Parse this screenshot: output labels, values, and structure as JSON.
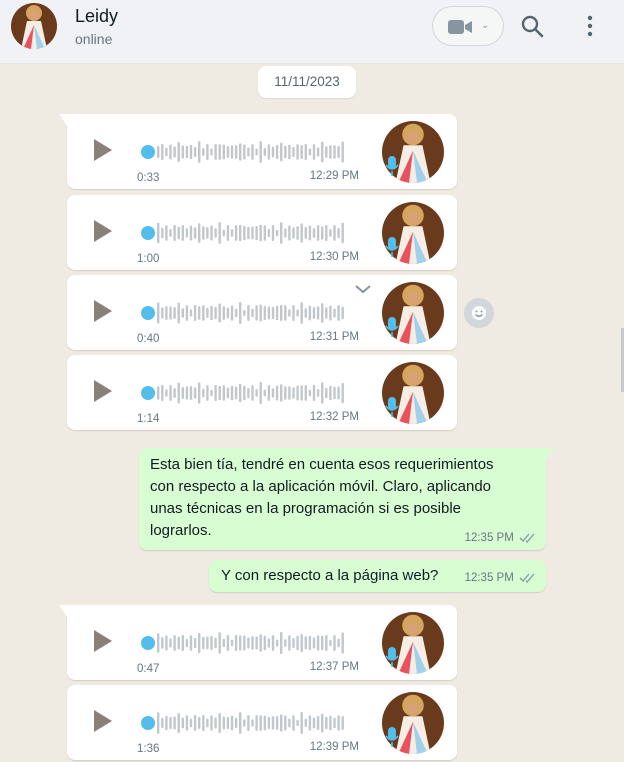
{
  "header": {
    "contact_name": "Leidy",
    "status": "online"
  },
  "chat": {
    "date_label": "11/11/2023",
    "voice_messages": [
      {
        "duration": "0:33",
        "time": "12:29 PM"
      },
      {
        "duration": "1:00",
        "time": "12:30 PM"
      },
      {
        "duration": "0:40",
        "time": "12:31 PM"
      },
      {
        "duration": "1:14",
        "time": "12:32 PM"
      },
      {
        "duration": "0:47",
        "time": "12:37 PM"
      },
      {
        "duration": "1:36",
        "time": "12:39 PM"
      }
    ],
    "outgoing": [
      {
        "lines": [
          "Esta bien tía, tendré en cuenta esos requerimientos",
          "con respecto a la aplicación móvil. Claro, aplicando",
          "unas técnicas en la programación si es posible",
          "lograrlos."
        ],
        "time": "12:35 PM"
      },
      {
        "lines": [
          "Y con respecto a la página web?"
        ],
        "time": "12:35 PM"
      }
    ]
  },
  "colors": {
    "chat_background": "#efeae2",
    "outgoing_bubble": "#d9fdd3",
    "incoming_bubble": "#ffffff",
    "playhead": "#53bdeb",
    "read_ticks": "#8696a0"
  },
  "icons": [
    "video-call-icon",
    "search-icon",
    "menu-icon",
    "play-icon",
    "mic-icon",
    "chevron-down-icon",
    "emoji-icon",
    "double-check-icon"
  ]
}
